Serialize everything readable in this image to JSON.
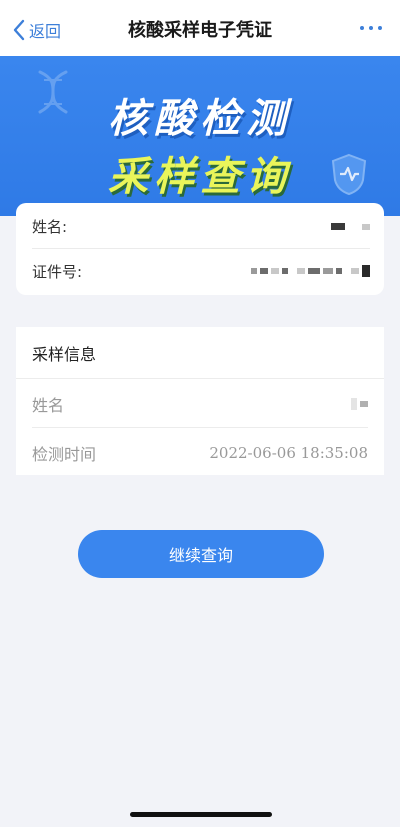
{
  "nav": {
    "back_label": "返回",
    "title": "核酸采样电子凭证",
    "more_icon": "more-dots-icon"
  },
  "banner": {
    "line1": "核酸检测",
    "line2": "采样查询",
    "colors": {
      "background": "#3a86ee",
      "line2": "#e9f55a"
    }
  },
  "personal": {
    "name_label": "姓名:",
    "id_label": "证件号:"
  },
  "sample_info": {
    "title": "采样信息",
    "name_label": "姓名",
    "time_label": "检测时间",
    "time_value": "2022-06-06 18:35:08"
  },
  "actions": {
    "continue_label": "继续查询",
    "accent": "#3a86ee"
  }
}
